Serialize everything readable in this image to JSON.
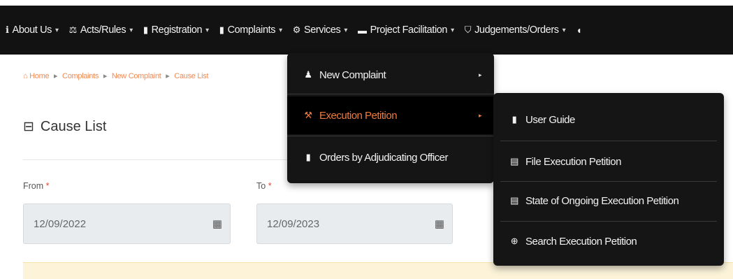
{
  "nav": {
    "items": [
      {
        "label": "About Us",
        "icon": "info-circle-icon",
        "glyph": "ℹ"
      },
      {
        "label": "Acts/Rules",
        "icon": "gavel-icon",
        "glyph": "⚖"
      },
      {
        "label": "Registration",
        "icon": "file-icon",
        "glyph": "▮"
      },
      {
        "label": "Complaints",
        "icon": "clipboard-icon",
        "glyph": "▮"
      },
      {
        "label": "Services",
        "icon": "cogs-icon",
        "glyph": "⚙"
      },
      {
        "label": "Project Facilitation",
        "icon": "folder-icon",
        "glyph": "▬"
      },
      {
        "label": "Judgements/Orders",
        "icon": "shield-icon",
        "glyph": "⛉"
      }
    ],
    "caret": "▾"
  },
  "breadcrumb": {
    "items": [
      "Home",
      "Complaints",
      "New Complaint",
      "Cause List"
    ],
    "separator": "▸",
    "home_icon": "home-icon"
  },
  "page": {
    "title": "Cause List",
    "title_icon": "list-icon",
    "title_glyph": "⊟"
  },
  "form": {
    "from_label": "From",
    "to_label": "To",
    "required_mark": "*",
    "from_value": "12/09/2022",
    "to_value": "12/09/2023",
    "calendar_glyph": "▦"
  },
  "menu_complaints": {
    "items": [
      {
        "label": "New Complaint",
        "icon": "user-icon",
        "glyph": "♟",
        "has_submenu": true,
        "active": false
      },
      {
        "label": "Execution Petition",
        "icon": "gavel-icon",
        "glyph": "⚒",
        "has_submenu": true,
        "active": true
      },
      {
        "label": "Orders by Adjudicating Officer",
        "icon": "file-icon",
        "glyph": "▮",
        "has_submenu": false,
        "active": false
      }
    ],
    "submenu_arrow": "▸"
  },
  "menu_execution": {
    "items": [
      {
        "label": "User Guide",
        "icon": "book-icon",
        "glyph": "▮"
      },
      {
        "label": "File Execution Petition",
        "icon": "file-text-icon",
        "glyph": "▤"
      },
      {
        "label": "State of Ongoing Execution Petition",
        "icon": "file-text-icon",
        "glyph": "▤"
      },
      {
        "label": "Search Execution Petition",
        "icon": "binoculars-icon",
        "glyph": "⊕"
      }
    ]
  },
  "colors": {
    "navbar_bg": "#121212",
    "menu_bg": "#151515",
    "accent": "#f07a3a",
    "field_bg": "#e9ecef",
    "alert_bg": "#fcf3d9"
  }
}
